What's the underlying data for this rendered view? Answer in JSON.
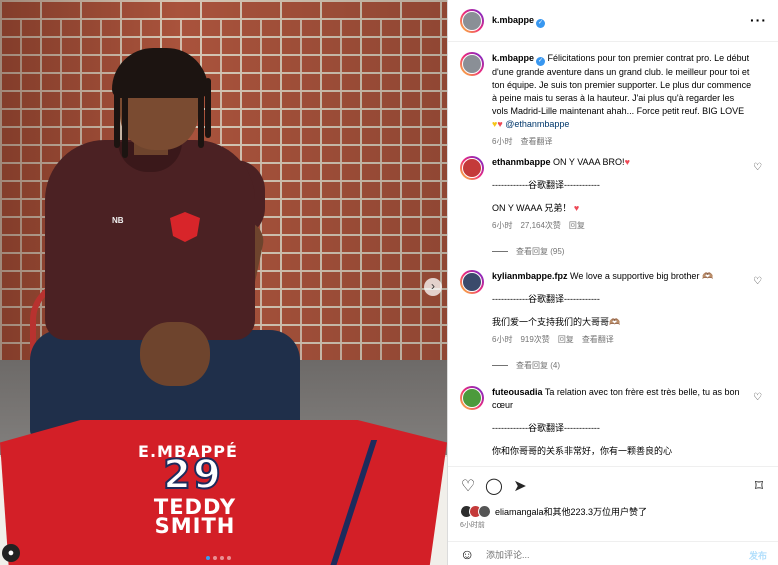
{
  "colors": {
    "accent": "#3897f0",
    "heart": "#ed4956",
    "link": "#00376b",
    "meta": "#737373"
  },
  "photo": {
    "jersey_name": "E.MBAPPÉ",
    "jersey_number": "29",
    "jersey_sponsor": "TEDDY SMITH",
    "shirt_brand": "NB",
    "slide_count": 4,
    "active_slide": 1
  },
  "header": {
    "username": "k.mbappe",
    "more_icon": "more-horizontal-icon"
  },
  "caption": {
    "username": "k.mbappe",
    "text": "Félicitations pour ton premier contrat pro. Le début d'une grande aventure dans un grand club. le meilleur pour toi et ton équipe. Je suis ton premier supporter. Le plus dur commence à peine mais tu seras à la hauteur. J'ai plus qu'à regarder les vols Madrid-Lille maintenant ahah... Force petit reuf. BIG LOVE",
    "mention": "@ethanmbappe",
    "time": "6小时",
    "translate": "查看翻译"
  },
  "comments": [
    {
      "username": "ethanmbappe",
      "text": "ON Y VAAA BRO!",
      "divider": "------------谷歌翻译------------",
      "translation": "ON Y WAAA 兄弟！",
      "time": "6小时",
      "likes": "27,164次赞",
      "reply": "回复",
      "view_replies": "查看回复 (95)"
    },
    {
      "username": "kylianmbappe.fpz",
      "text": "We love a supportive big brother 🫶🏽",
      "divider": "------------谷歌翻译------------",
      "translation": "我们爱一个支持我们的大哥哥🫶🏽",
      "time": "6小时",
      "likes": "919次赞",
      "reply": "回复",
      "see_translation": "查看翻译",
      "view_replies": "查看回复 (4)"
    },
    {
      "username": "futeousadia",
      "text": "Ta relation avec ton frère est très belle, tu as bon cœur",
      "divider": "------------谷歌翻译------------",
      "translation": "你和你哥哥的关系非常好，你有一颗善良的心"
    }
  ],
  "actions": {
    "likes_text": "eliamangala和其他223.3万位用户赞了",
    "time_ago": "6小时前",
    "comment_placeholder": "添加评论...",
    "post_label": "发布"
  }
}
